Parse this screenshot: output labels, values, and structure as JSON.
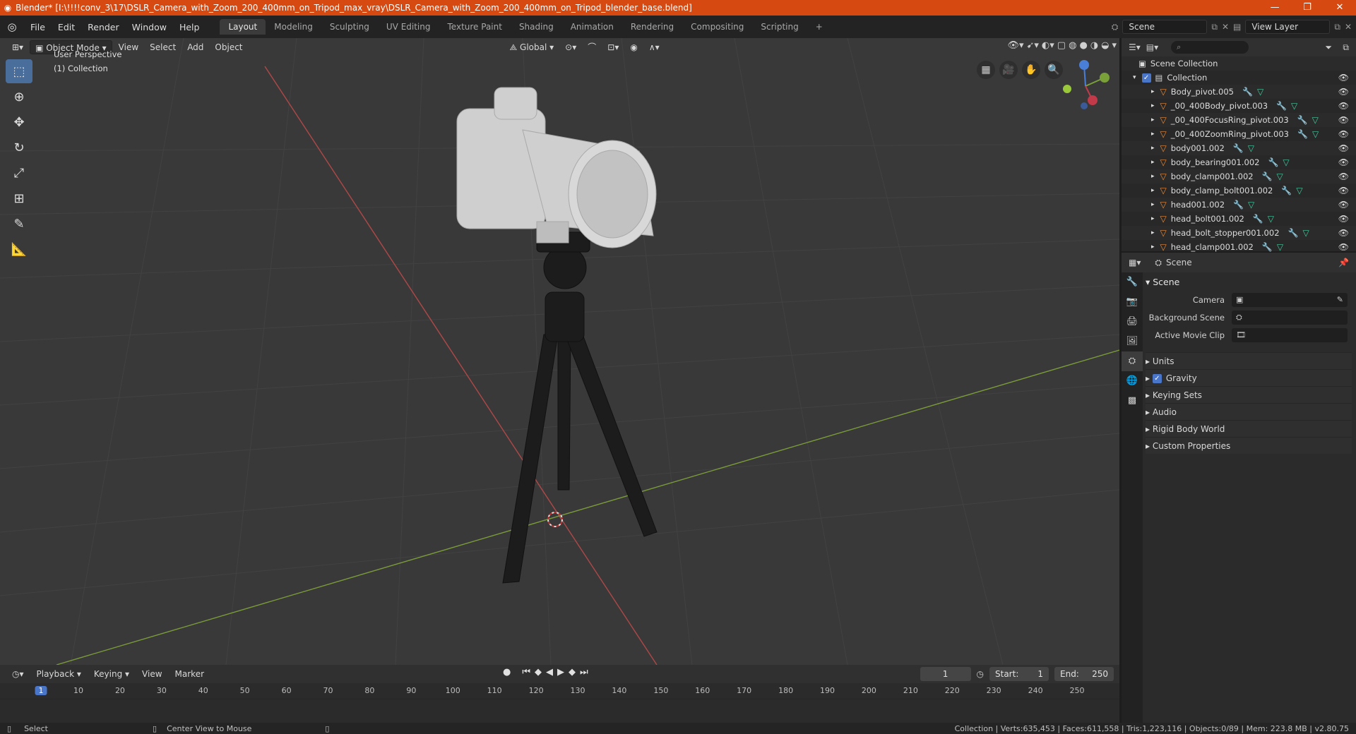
{
  "window": {
    "title": "Blender* [I:\\!!!!conv_3\\17\\DSLR_Camera_with_Zoom_200_400mm_on_Tripod_max_vray\\DSLR_Camera_with_Zoom_200_400mm_on_Tripod_blender_base.blend]"
  },
  "menu": [
    "File",
    "Edit",
    "Render",
    "Window",
    "Help"
  ],
  "workspaces": [
    "Layout",
    "Modeling",
    "Sculpting",
    "UV Editing",
    "Texture Paint",
    "Shading",
    "Animation",
    "Rendering",
    "Compositing",
    "Scripting"
  ],
  "active_workspace": "Layout",
  "scene_selector": "Scene",
  "view_layer": "View Layer",
  "viewport": {
    "mode": "Object Mode",
    "menus": [
      "View",
      "Select",
      "Add",
      "Object"
    ],
    "orientation": "Global",
    "perspective_label": "User Perspective",
    "collection_label": "(1) Collection"
  },
  "timeline": {
    "menus": [
      "Playback",
      "Keying",
      "View",
      "Marker"
    ],
    "current_frame": "1",
    "start_label": "Start:",
    "start": "1",
    "end_label": "End:",
    "end": "250",
    "ruler": [
      "1",
      "10",
      "20",
      "30",
      "40",
      "50",
      "60",
      "70",
      "80",
      "90",
      "100",
      "110",
      "120",
      "130",
      "140",
      "150",
      "160",
      "170",
      "180",
      "190",
      "200",
      "210",
      "220",
      "230",
      "240",
      "250"
    ]
  },
  "statusbar": {
    "left": "Select",
    "middle": "Center View to Mouse",
    "right": "Collection | Verts:635,453 | Faces:611,558 | Tris:1,223,116 | Objects:0/89 | Mem: 223.8 MB | v2.80.75"
  },
  "outliner": {
    "root": "Scene Collection",
    "collection": "Collection",
    "items": [
      "Body_pivot.005",
      "_00_400Body_pivot.003",
      "_00_400FocusRing_pivot.003",
      "_00_400ZoomRing_pivot.003",
      "body001.002",
      "body_bearing001.002",
      "body_clamp001.002",
      "body_clamp_bolt001.002",
      "head001.002",
      "head_bolt001.002",
      "head_bolt_stopper001.002",
      "head_clamp001.002"
    ]
  },
  "properties": {
    "header": "Scene",
    "panel": "Scene",
    "camera_label": "Camera",
    "background_scene_label": "Background Scene",
    "active_movie_clip_label": "Active Movie Clip",
    "subpanels": [
      "Units",
      "Gravity",
      "Keying Sets",
      "Audio",
      "Rigid Body World",
      "Custom Properties"
    ]
  }
}
